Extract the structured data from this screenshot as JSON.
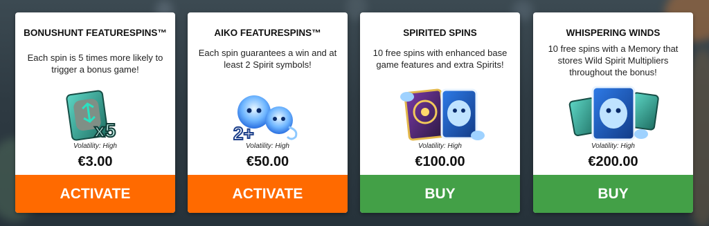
{
  "colors": {
    "activate_button": "#ff6a00",
    "buy_button": "#43a047",
    "card_bg": "#ffffff",
    "title_text": "#111111"
  },
  "cards": [
    {
      "title": "BONUSHUNT FEATURESPINS™",
      "description": "Each spin is 5 times more likely to trigger a bonus game!",
      "volatility": "Volatility: High",
      "price": "€3.00",
      "button": "ACTIVATE",
      "art_text": "x5",
      "icon": "rune-stone-x5-icon"
    },
    {
      "title": "AIKO FEATURESPINS™",
      "description": "Each spin guarantees a win and at least 2 Spirit symbols!",
      "volatility": "Volatility: High",
      "price": "€50.00",
      "button": "ACTIVATE",
      "art_text": "2+",
      "icon": "blue-spirits-icon"
    },
    {
      "title": "SPIRITED SPINS",
      "description": "10 free spins with enhanced base game features and extra Spirits!",
      "volatility": "Volatility: High",
      "price": "€100.00",
      "button": "BUY",
      "icon": "spirit-cards-icon"
    },
    {
      "title": "WHISPERING WINDS",
      "description": "10 free spins with a Memory that stores Wild Spirit Multipliers throughout the bonus!",
      "volatility": "Volatility: High",
      "price": "€200.00",
      "button": "BUY",
      "icon": "spirit-rune-cards-icon"
    }
  ]
}
